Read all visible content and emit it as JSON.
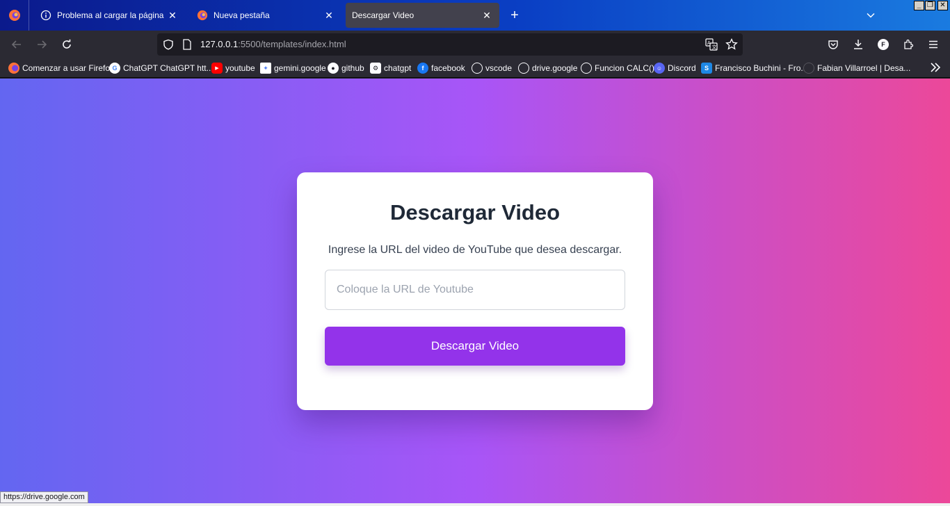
{
  "tabs": [
    {
      "title": "Problema al cargar la página",
      "icon": "info-icon"
    },
    {
      "title": "Nueva pestaña",
      "icon": "firefox-icon"
    },
    {
      "title": "Descargar Video",
      "icon": "none",
      "active": true
    }
  ],
  "window_controls": {
    "minimize": "_",
    "restore": "❐",
    "close": "✕"
  },
  "url": {
    "host": "127.0.0.1",
    "rest": ":5500/templates/index.html"
  },
  "bookmarks": [
    {
      "label": "Comenzar a usar Firefox",
      "icon": "firefox-icon"
    },
    {
      "label": "ChatGPT ChatGPT htt...",
      "icon": "google-icon"
    },
    {
      "label": "youtube",
      "icon": "youtube-icon"
    },
    {
      "label": "gemini.google",
      "icon": "gemini-icon"
    },
    {
      "label": "github",
      "icon": "github-icon"
    },
    {
      "label": "chatgpt",
      "icon": "openai-icon"
    },
    {
      "label": "facebook",
      "icon": "facebook-icon"
    },
    {
      "label": "vscode",
      "icon": "globe-icon"
    },
    {
      "label": "drive.google",
      "icon": "globe-icon"
    },
    {
      "label": "Funcion CALC()",
      "icon": "globe-icon"
    },
    {
      "label": "Discord",
      "icon": "discord-icon"
    },
    {
      "label": "Francisco Buchini - Fro...",
      "icon": "site-icon"
    },
    {
      "label": "Fabian Villarroel | Desa...",
      "icon": "site-icon"
    }
  ],
  "profile_initial": "F",
  "main": {
    "title": "Descargar Video",
    "description": "Ingrese la URL del video de YouTube que desea descargar.",
    "input_placeholder": "Coloque la URL de Youtube",
    "input_value": "",
    "button_label": "Descargar Video"
  },
  "status_bar": "https://drive.google.com",
  "colors": {
    "accent": "#9333ea",
    "gradient_start": "#6366f1",
    "gradient_mid": "#a855f7",
    "gradient_end": "#ec4899"
  }
}
